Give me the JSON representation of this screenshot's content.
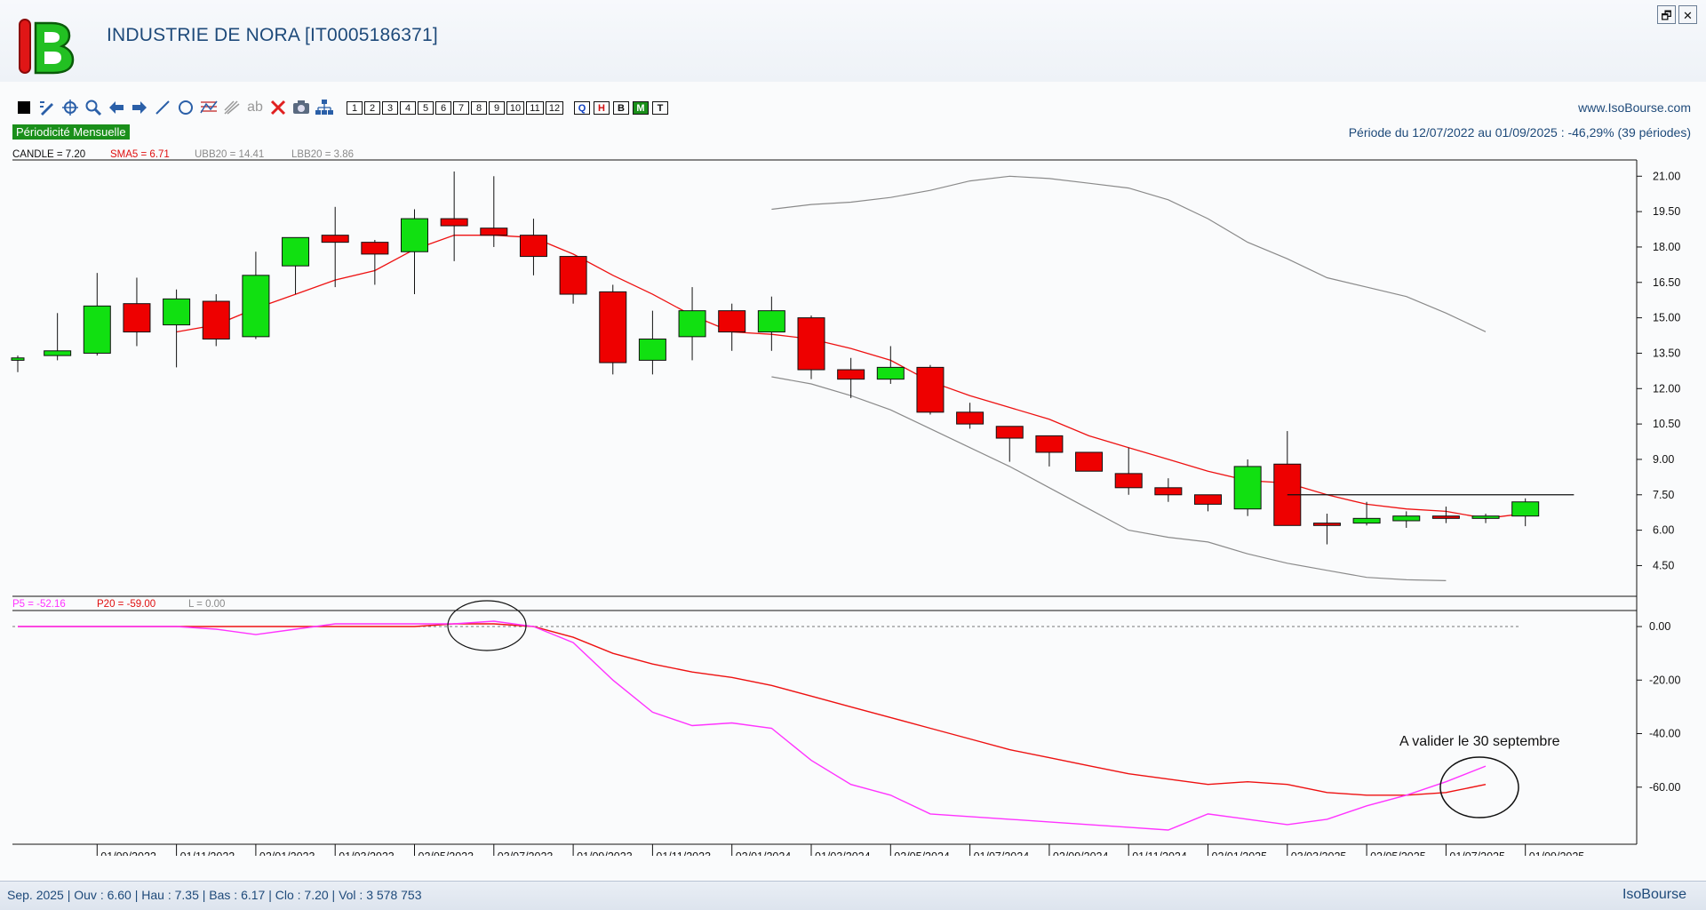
{
  "app": {
    "title": "INDUSTRIE DE NORA [IT0005186371]",
    "website": "www.IsoBourse.com",
    "periodicity": "Périodicité Mensuelle",
    "period_info": "Période du 12/07/2022 au 01/09/2025 : -46,29% (39 périodes)",
    "status_text": "Sep. 2025 | Ouv : 6.60 | Hau : 7.35 | Bas : 6.17 | Clo : 7.20 | Vol : 3 578 753",
    "brand": "IsoBourse",
    "restore_label": "🗗",
    "close_label": "✕"
  },
  "toolbar": {
    "period_buttons": [
      "1",
      "2",
      "3",
      "4",
      "5",
      "6",
      "7",
      "8",
      "9",
      "10",
      "11",
      "12"
    ],
    "scale_buttons": [
      {
        "label": "Q",
        "color": "#1040c0"
      },
      {
        "label": "H",
        "color": "#d01010"
      },
      {
        "label": "B",
        "color": "#111111"
      },
      {
        "label": "M",
        "color": "#ffffff",
        "bg": "#1a8f1a"
      },
      {
        "label": "T",
        "color": "#111111"
      }
    ],
    "icons": [
      "square-icon",
      "pencil-icon",
      "crosshair-icon",
      "zoom-icon",
      "arrow-left-icon",
      "arrow-right-icon",
      "line-icon",
      "circle-icon",
      "chart-lines-icon",
      "fibonacci-icon",
      "text-ab-icon",
      "delete-icon",
      "camera-icon",
      "hierarchy-icon"
    ]
  },
  "legend_top": {
    "candle": "CANDLE = 7.20",
    "sma": "SMA5 = 6.71",
    "ubb": "UBB20 = 14.41",
    "lbb": "LBB20 = 3.86"
  },
  "legend_bottom": {
    "p5": "P5 = -52.16",
    "p20": "P20 = -59.00",
    "l": "L = 0.00"
  },
  "annotation": "A valider le 30 septembre",
  "colors": {
    "up": "#11e011",
    "down": "#ee0000",
    "sma": "#ee1111",
    "bollinger": "#8a8a8a",
    "p5": "#ff33ff",
    "p20": "#ee1111"
  },
  "chart_data": [
    {
      "type": "candlestick",
      "ylim": [
        3.5,
        21.5
      ],
      "y_ticks": [
        "21.00",
        "19.50",
        "18.00",
        "16.50",
        "15.00",
        "13.50",
        "12.00",
        "10.50",
        "9.00",
        "7.50",
        "6.00",
        "4.50"
      ],
      "x_ticks": [
        "01/09/2022",
        "01/11/2022",
        "02/01/2023",
        "01/03/2023",
        "02/05/2023",
        "03/07/2023",
        "01/09/2023",
        "01/11/2023",
        "02/01/2024",
        "01/03/2024",
        "02/05/2024",
        "01/07/2024",
        "02/09/2024",
        "01/11/2024",
        "02/01/2025",
        "03/03/2025",
        "02/05/2025",
        "01/07/2025",
        "01/09/2025"
      ],
      "candles": [
        {
          "o": 13.2,
          "h": 13.4,
          "l": 12.7,
          "c": 13.3
        },
        {
          "o": 13.4,
          "h": 15.2,
          "l": 13.2,
          "c": 13.6
        },
        {
          "o": 13.5,
          "h": 16.9,
          "l": 13.4,
          "c": 15.5
        },
        {
          "o": 15.6,
          "h": 16.7,
          "l": 13.8,
          "c": 14.4
        },
        {
          "o": 14.7,
          "h": 16.2,
          "l": 12.9,
          "c": 15.8
        },
        {
          "o": 15.7,
          "h": 16.0,
          "l": 13.8,
          "c": 14.1
        },
        {
          "o": 14.2,
          "h": 17.8,
          "l": 14.1,
          "c": 16.8
        },
        {
          "o": 17.2,
          "h": 18.4,
          "l": 16.0,
          "c": 18.4
        },
        {
          "o": 18.5,
          "h": 19.7,
          "l": 16.3,
          "c": 18.2
        },
        {
          "o": 18.2,
          "h": 18.3,
          "l": 16.4,
          "c": 17.7
        },
        {
          "o": 17.8,
          "h": 19.6,
          "l": 16.0,
          "c": 19.2
        },
        {
          "o": 19.2,
          "h": 21.2,
          "l": 17.4,
          "c": 18.9
        },
        {
          "o": 18.8,
          "h": 21.0,
          "l": 18.0,
          "c": 18.5
        },
        {
          "o": 18.5,
          "h": 19.2,
          "l": 16.8,
          "c": 17.6
        },
        {
          "o": 17.6,
          "h": 17.6,
          "l": 15.6,
          "c": 16.0
        },
        {
          "o": 16.1,
          "h": 16.4,
          "l": 12.6,
          "c": 13.1
        },
        {
          "o": 13.2,
          "h": 15.3,
          "l": 12.6,
          "c": 14.1
        },
        {
          "o": 14.2,
          "h": 16.3,
          "l": 13.2,
          "c": 15.3
        },
        {
          "o": 15.3,
          "h": 15.6,
          "l": 13.6,
          "c": 14.4
        },
        {
          "o": 14.4,
          "h": 15.9,
          "l": 13.6,
          "c": 15.3
        },
        {
          "o": 15.0,
          "h": 15.1,
          "l": 12.4,
          "c": 12.8
        },
        {
          "o": 12.8,
          "h": 13.3,
          "l": 11.6,
          "c": 12.4
        },
        {
          "o": 12.4,
          "h": 13.8,
          "l": 12.2,
          "c": 12.9
        },
        {
          "o": 12.9,
          "h": 13.0,
          "l": 10.9,
          "c": 11.0
        },
        {
          "o": 11.0,
          "h": 11.4,
          "l": 10.3,
          "c": 10.5
        },
        {
          "o": 10.4,
          "h": 10.4,
          "l": 8.9,
          "c": 9.9
        },
        {
          "o": 10.0,
          "h": 10.0,
          "l": 8.7,
          "c": 9.3
        },
        {
          "o": 9.3,
          "h": 9.3,
          "l": 8.5,
          "c": 8.5
        },
        {
          "o": 8.4,
          "h": 9.5,
          "l": 7.5,
          "c": 7.8
        },
        {
          "o": 7.8,
          "h": 8.2,
          "l": 7.2,
          "c": 7.5
        },
        {
          "o": 7.5,
          "h": 7.5,
          "l": 6.8,
          "c": 7.1
        },
        {
          "o": 6.9,
          "h": 9.0,
          "l": 6.6,
          "c": 8.7
        },
        {
          "o": 8.8,
          "h": 10.2,
          "l": 6.2,
          "c": 6.2
        },
        {
          "o": 6.3,
          "h": 6.7,
          "l": 5.4,
          "c": 6.2
        },
        {
          "o": 6.3,
          "h": 7.2,
          "l": 6.2,
          "c": 6.5
        },
        {
          "o": 6.4,
          "h": 6.8,
          "l": 6.1,
          "c": 6.6
        },
        {
          "o": 6.6,
          "h": 7.0,
          "l": 6.3,
          "c": 6.5
        },
        {
          "o": 6.5,
          "h": 6.7,
          "l": 6.3,
          "c": 6.6
        },
        {
          "o": 6.6,
          "h": 7.35,
          "l": 6.17,
          "c": 7.2
        }
      ],
      "sma5": [
        null,
        null,
        null,
        null,
        14.4,
        14.7,
        15.4,
        16.0,
        16.6,
        17.0,
        17.9,
        18.5,
        18.5,
        18.4,
        17.7,
        16.8,
        16.0,
        15.1,
        14.4,
        14.3,
        14.1,
        13.7,
        13.2,
        12.3,
        11.7,
        11.2,
        10.7,
        10.0,
        9.5,
        9.0,
        8.5,
        8.1,
        8.0,
        7.5,
        7.1,
        6.9,
        6.8,
        6.5,
        6.71
      ],
      "ubb20": [
        null,
        null,
        null,
        null,
        null,
        null,
        null,
        null,
        null,
        null,
        null,
        null,
        null,
        null,
        null,
        null,
        null,
        null,
        null,
        19.6,
        19.8,
        19.9,
        20.1,
        20.4,
        20.8,
        21.0,
        20.9,
        20.7,
        20.5,
        20.0,
        19.2,
        18.2,
        17.5,
        16.7,
        16.3,
        15.9,
        15.2,
        14.41,
        null
      ],
      "lbb20": [
        null,
        null,
        null,
        null,
        null,
        null,
        null,
        null,
        null,
        null,
        null,
        null,
        null,
        null,
        null,
        null,
        null,
        null,
        null,
        12.5,
        12.2,
        11.7,
        11.1,
        10.3,
        9.5,
        8.7,
        7.8,
        6.9,
        6.0,
        5.7,
        5.5,
        5.0,
        4.6,
        4.3,
        4.0,
        3.9,
        3.86,
        null,
        null
      ],
      "resistance": {
        "value": 7.5,
        "from_index": 32,
        "to_index": 39
      }
    },
    {
      "type": "line",
      "ylim": [
        -80,
        3
      ],
      "y_ticks": [
        "0.00",
        "-20.00",
        "-40.00",
        "-60.00"
      ],
      "series": [
        {
          "name": "P5",
          "values": [
            0,
            0,
            0,
            0,
            0,
            -1,
            -3,
            -1,
            1,
            1,
            1,
            1,
            2,
            0,
            -6,
            -20,
            -32,
            -37,
            -36,
            -38,
            -50,
            -59,
            -63,
            -70,
            -71,
            -72,
            -73,
            -74,
            -75,
            -76,
            -70,
            -72,
            -74,
            -72,
            -67,
            -63,
            -58,
            -52.16
          ]
        },
        {
          "name": "P20",
          "values": [
            0,
            0,
            0,
            0,
            0,
            0,
            0,
            0,
            0,
            0,
            0,
            1,
            1,
            0,
            -4,
            -10,
            -14,
            -17,
            -19,
            -22,
            -26,
            -30,
            -34,
            -38,
            -42,
            -46,
            -49,
            -52,
            -55,
            -57,
            -59,
            -58,
            -59,
            -62,
            -63,
            -63,
            -62,
            -59.0
          ]
        }
      ],
      "zero_line": 0
    }
  ]
}
